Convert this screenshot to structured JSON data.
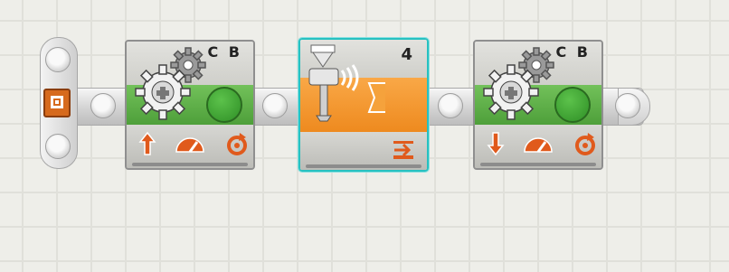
{
  "colors": {
    "canvas": "#eeeee9",
    "motor_green": "#5cb043",
    "sensor_orange": "#f29a2e",
    "selection": "#27c1c1",
    "icon_orange": "#e05a1c"
  },
  "start": {
    "icon": "start-square-icon"
  },
  "blocks": [
    {
      "type": "motor",
      "ports": "C B",
      "direction_icon": "arrow-up-icon",
      "power_icon": "power-gauge-icon",
      "duration_icon": "rotation-icon"
    },
    {
      "type": "wait-sound",
      "value": "4",
      "icon": "sound-sensor-icon",
      "action_icon": "wait-compare-icon",
      "selected": true
    },
    {
      "type": "motor",
      "ports": "C B",
      "direction_icon": "arrow-down-icon",
      "power_icon": "power-gauge-icon",
      "duration_icon": "rotation-icon"
    }
  ]
}
